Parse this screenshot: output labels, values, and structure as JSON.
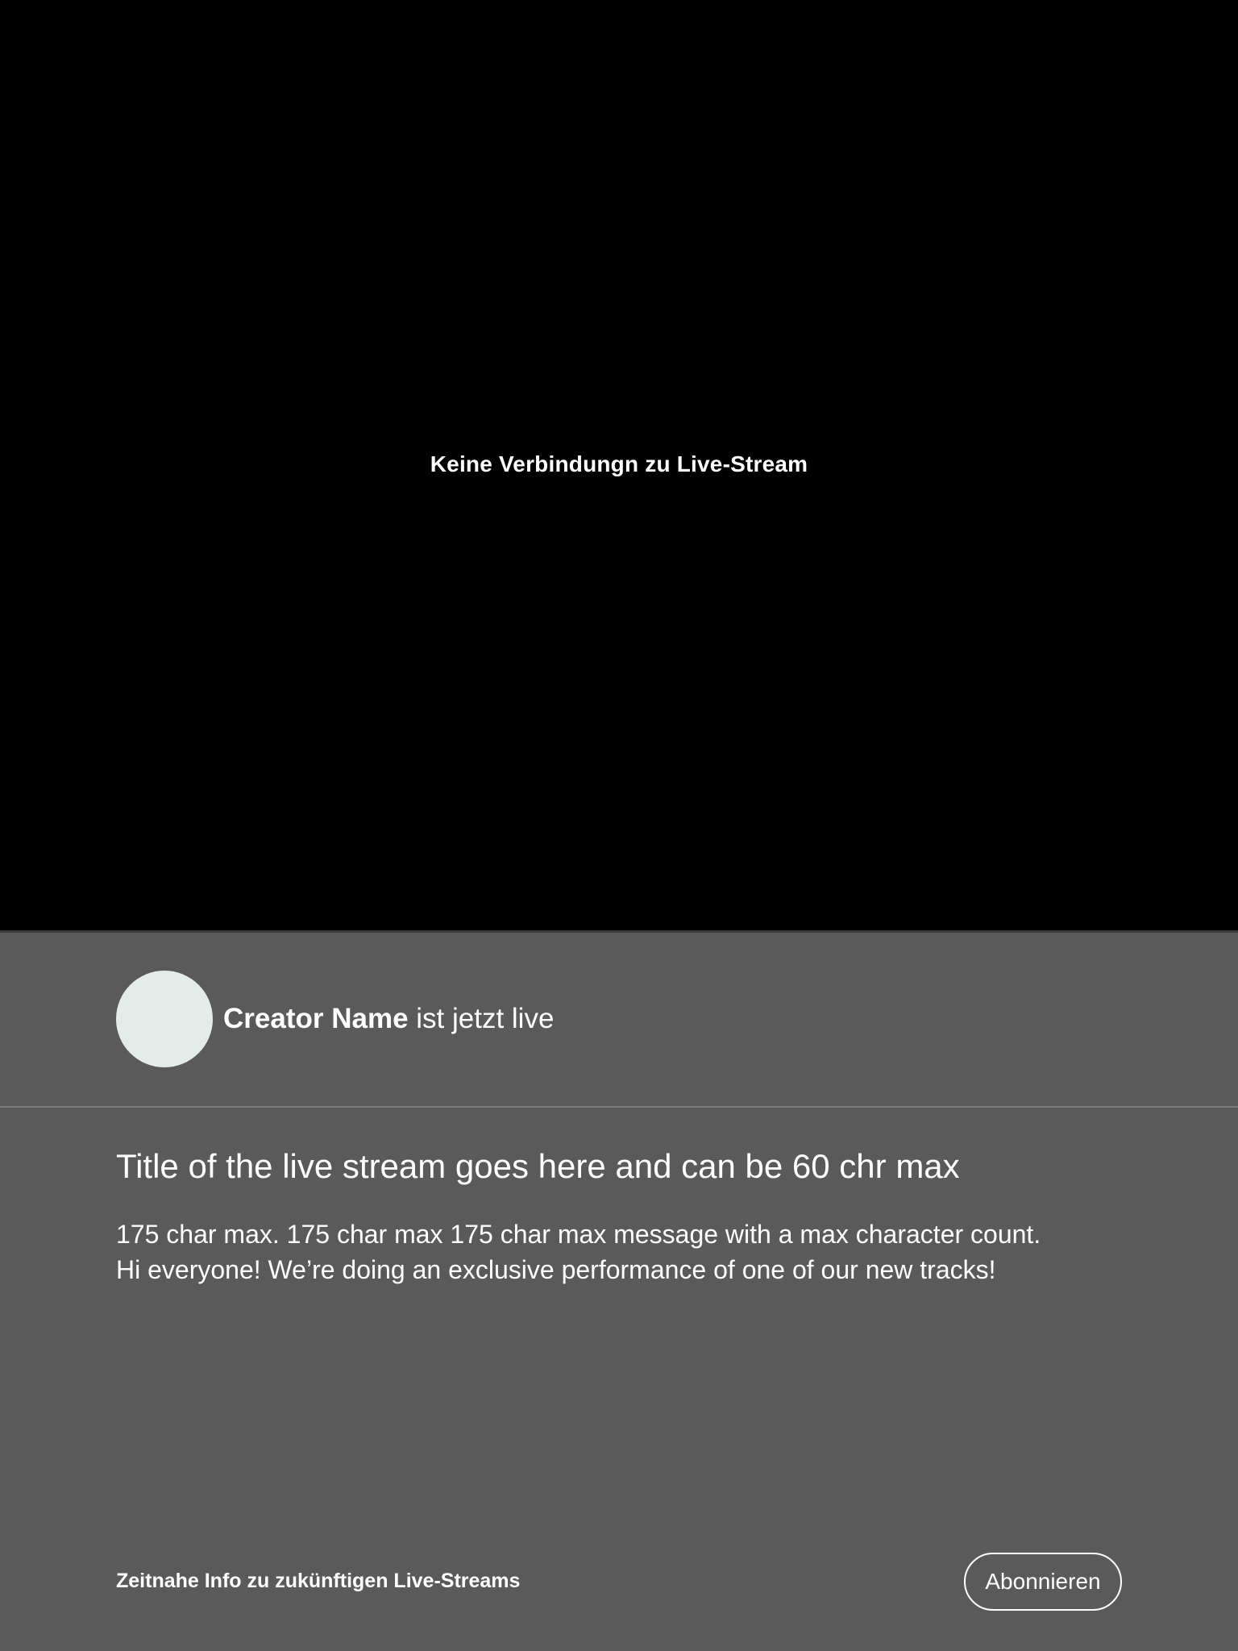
{
  "video": {
    "status_text": "Keine Verbindungn zu Live-Stream"
  },
  "creator": {
    "name": "Creator Name",
    "live_suffix": " ist jetzt live"
  },
  "stream": {
    "title": "Title of the live stream goes here and can be 60 chr max",
    "description_lines": [
      "175 char max. 175 char max 175 char max message with a max character count.",
      "Hi everyone! We’re doing an exclusive performance of one of our new tracks!"
    ]
  },
  "footer": {
    "info_text": "Zeitnahe Info zu zukünftigen Live-Streams",
    "subscribe_label": "Abonnieren"
  },
  "colors": {
    "video_background": "#000000",
    "panel_background": "#5a5a5a",
    "avatar_placeholder": "#e3ece8",
    "text": "#ffffff"
  }
}
